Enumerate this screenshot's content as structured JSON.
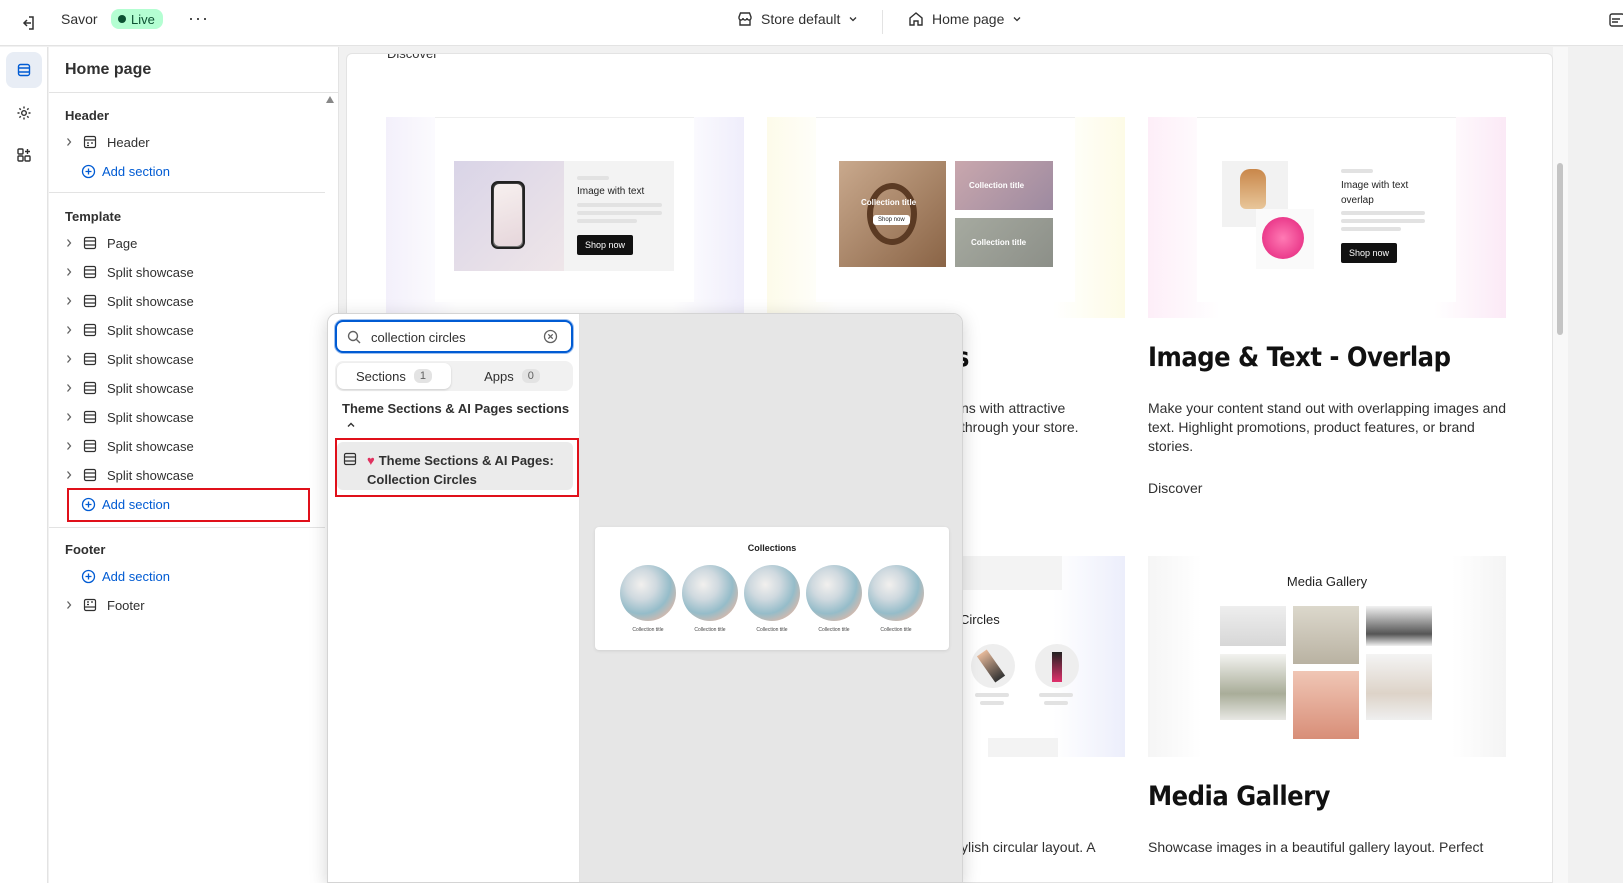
{
  "topbar": {
    "theme_name": "Savor",
    "live_label": "Live",
    "more_label": "···",
    "store_selector": "Store default",
    "page_selector": "Home page"
  },
  "sidebar": {
    "title": "Home page",
    "header_group": "Header",
    "header_item": "Header",
    "template_group": "Template",
    "template_items": [
      "Page",
      "Split showcase",
      "Split showcase",
      "Split showcase",
      "Split showcase",
      "Split showcase",
      "Split showcase",
      "Split showcase",
      "Split showcase"
    ],
    "footer_group": "Footer",
    "footer_item": "Footer",
    "add_section": "Add section"
  },
  "picker": {
    "search_value": "collection circles",
    "tabs": [
      {
        "label": "Sections",
        "count": "1"
      },
      {
        "label": "Apps",
        "count": "0"
      }
    ],
    "category": "Theme Sections & AI Pages sections",
    "result_line1": "Theme Sections & AI Pages:",
    "result_line2": "Collection Circles",
    "preview_title": "Collections",
    "preview_items": [
      "Collection title",
      "Collection title",
      "Collection title",
      "Collection title",
      "Collection title"
    ]
  },
  "preview": {
    "cut_text": "Discover",
    "card1_thumb_heading": "Image with text",
    "card1_shop": "Shop now",
    "card2_thumb_coll1": "Collection title",
    "card2_thumb_coll2": "Collection title",
    "card2_thumb_coll3": "Collection title",
    "card2_shop": "Shop now",
    "card2_title_tail": "s",
    "card2_desc_line1": "ns with attractive",
    "card2_desc_line2": "through your store.",
    "card3_thumb_heading": "Image with text overlap",
    "card3_shop": "Shop now",
    "card3_title": "Image & Text - Overlap",
    "card3_desc": "Make your content stand out with overlapping images and text. Highlight promotions, product features, or brand stories.",
    "card3_link": "Discover",
    "card5_thumb_tail": "Circles",
    "card5_desc_tail": "ylish circular layout. A",
    "card6_thumb_heading": "Media Gallery",
    "card6_title": "Media Gallery",
    "card6_desc": "Showcase images in a beautiful gallery layout. Perfect"
  },
  "colors": {
    "accent": "#005bd3",
    "highlight": "#e0101a",
    "live_bg": "#b4fed2",
    "live_fg": "#0c5132"
  }
}
